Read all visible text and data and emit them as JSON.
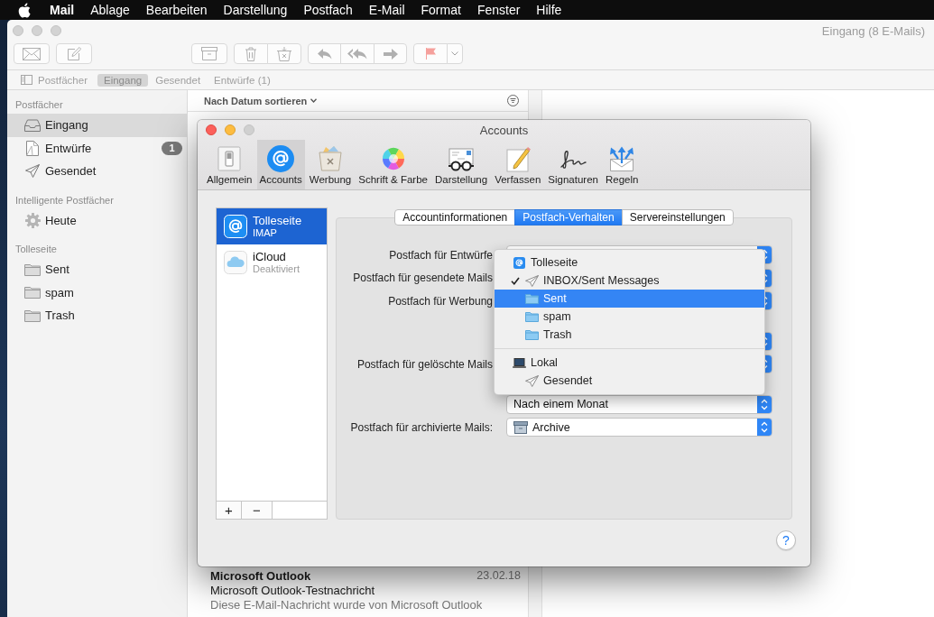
{
  "menu_bar": {
    "app": "Mail",
    "menus": [
      "Ablage",
      "Bearbeiten",
      "Darstellung",
      "Postfach",
      "E-Mail",
      "Format",
      "Fenster",
      "Hilfe"
    ]
  },
  "mail_window": {
    "title": "Eingang (8 E-Mails)",
    "favorites_bar": {
      "toggle": "Postfächer",
      "items": [
        {
          "label": "Eingang",
          "selected": true
        },
        {
          "label": "Gesendet",
          "selected": false
        },
        {
          "label": "Entwürfe (1)",
          "selected": false
        }
      ]
    },
    "sidebar": {
      "sections": [
        {
          "title": "Postfächer",
          "items": [
            {
              "label": "Eingang",
              "kind": "inbox",
              "selected": true
            },
            {
              "label": "Entwürfe",
              "kind": "drafts",
              "selected": false,
              "badge": "1"
            },
            {
              "label": "Gesendet",
              "kind": "sent",
              "selected": false
            }
          ]
        },
        {
          "title": "Intelligente Postfächer",
          "items": [
            {
              "label": "Heute",
              "kind": "smart",
              "selected": false
            }
          ]
        },
        {
          "title": "Tolleseite",
          "items": [
            {
              "label": "Sent",
              "kind": "folder",
              "selected": false
            },
            {
              "label": "spam",
              "kind": "folder",
              "selected": false
            },
            {
              "label": "Trash",
              "kind": "folder",
              "selected": false
            }
          ]
        }
      ]
    },
    "message_list": {
      "sort_label": "Nach Datum sortieren",
      "messages": [
        {
          "sender": "Microsoft Outlook",
          "date": "23.02.18",
          "subject": "Microsoft Outlook-Testnachricht",
          "preview": "Diese E-Mail-Nachricht wurde von Microsoft Outlook"
        }
      ]
    }
  },
  "accounts_window": {
    "title": "Accounts",
    "toolbar": [
      {
        "label": "Allgemein",
        "kind": "general",
        "selected": false
      },
      {
        "label": "Accounts",
        "kind": "accounts",
        "selected": true
      },
      {
        "label": "Werbung",
        "kind": "junk",
        "selected": false
      },
      {
        "label": "Schrift & Farbe",
        "kind": "fonts",
        "selected": false
      },
      {
        "label": "Darstellung",
        "kind": "viewing",
        "selected": false
      },
      {
        "label": "Verfassen",
        "kind": "composing",
        "selected": false
      },
      {
        "label": "Signaturen",
        "kind": "signatures",
        "selected": false
      },
      {
        "label": "Regeln",
        "kind": "rules",
        "selected": false
      }
    ],
    "accounts": [
      {
        "name": "Tolleseite",
        "type": "IMAP",
        "kind": "imap",
        "selected": true,
        "disabled": false
      },
      {
        "name": "iCloud",
        "type": "Deaktiviert",
        "kind": "icloud",
        "selected": false,
        "disabled": true
      }
    ],
    "list_buttons": [
      {
        "label": "+",
        "kind": "add"
      },
      {
        "label": "−",
        "kind": "remove"
      }
    ],
    "tabs": [
      {
        "label": "Accountinformationen",
        "selected": false
      },
      {
        "label": "Postfach-Verhalten",
        "selected": true
      },
      {
        "label": "Servereinstellungen",
        "selected": false
      }
    ],
    "setting_groups": [
      {
        "rows": [
          {
            "label": "Postfach für Entwürfe",
            "kind": "plain"
          },
          {
            "label": "Postfach für gesendete Mails",
            "kind": "plain"
          },
          {
            "label": "Postfach für Werbung",
            "kind": "plain"
          }
        ]
      },
      {
        "rows": [
          {
            "kind": "plain"
          },
          {
            "label": "Postfach für gelöschte Mails",
            "kind": "plain"
          }
        ]
      },
      {
        "rows": [
          {
            "value": "Nach einem Monat",
            "kind": "plain"
          },
          {
            "label": "Postfach für archivierte Mails:",
            "value": "Archive",
            "kind": "archive"
          }
        ]
      }
    ],
    "mailbox_menu": {
      "sections": [
        {
          "title": "Tolleseite",
          "kind": "account",
          "items": [
            {
              "label": "INBOX/Sent Messages",
              "kind": "sent",
              "checked": true,
              "selected": false
            },
            {
              "label": "Sent",
              "kind": "folder",
              "checked": false,
              "selected": true
            },
            {
              "label": "spam",
              "kind": "folder",
              "checked": false,
              "selected": false
            },
            {
              "label": "Trash",
              "kind": "folder",
              "checked": false,
              "selected": false
            }
          ]
        },
        {
          "title": "Lokal",
          "kind": "local",
          "items": [
            {
              "label": "Gesendet",
              "kind": "sent",
              "checked": false,
              "selected": false
            }
          ]
        }
      ]
    },
    "help_button": "?"
  }
}
